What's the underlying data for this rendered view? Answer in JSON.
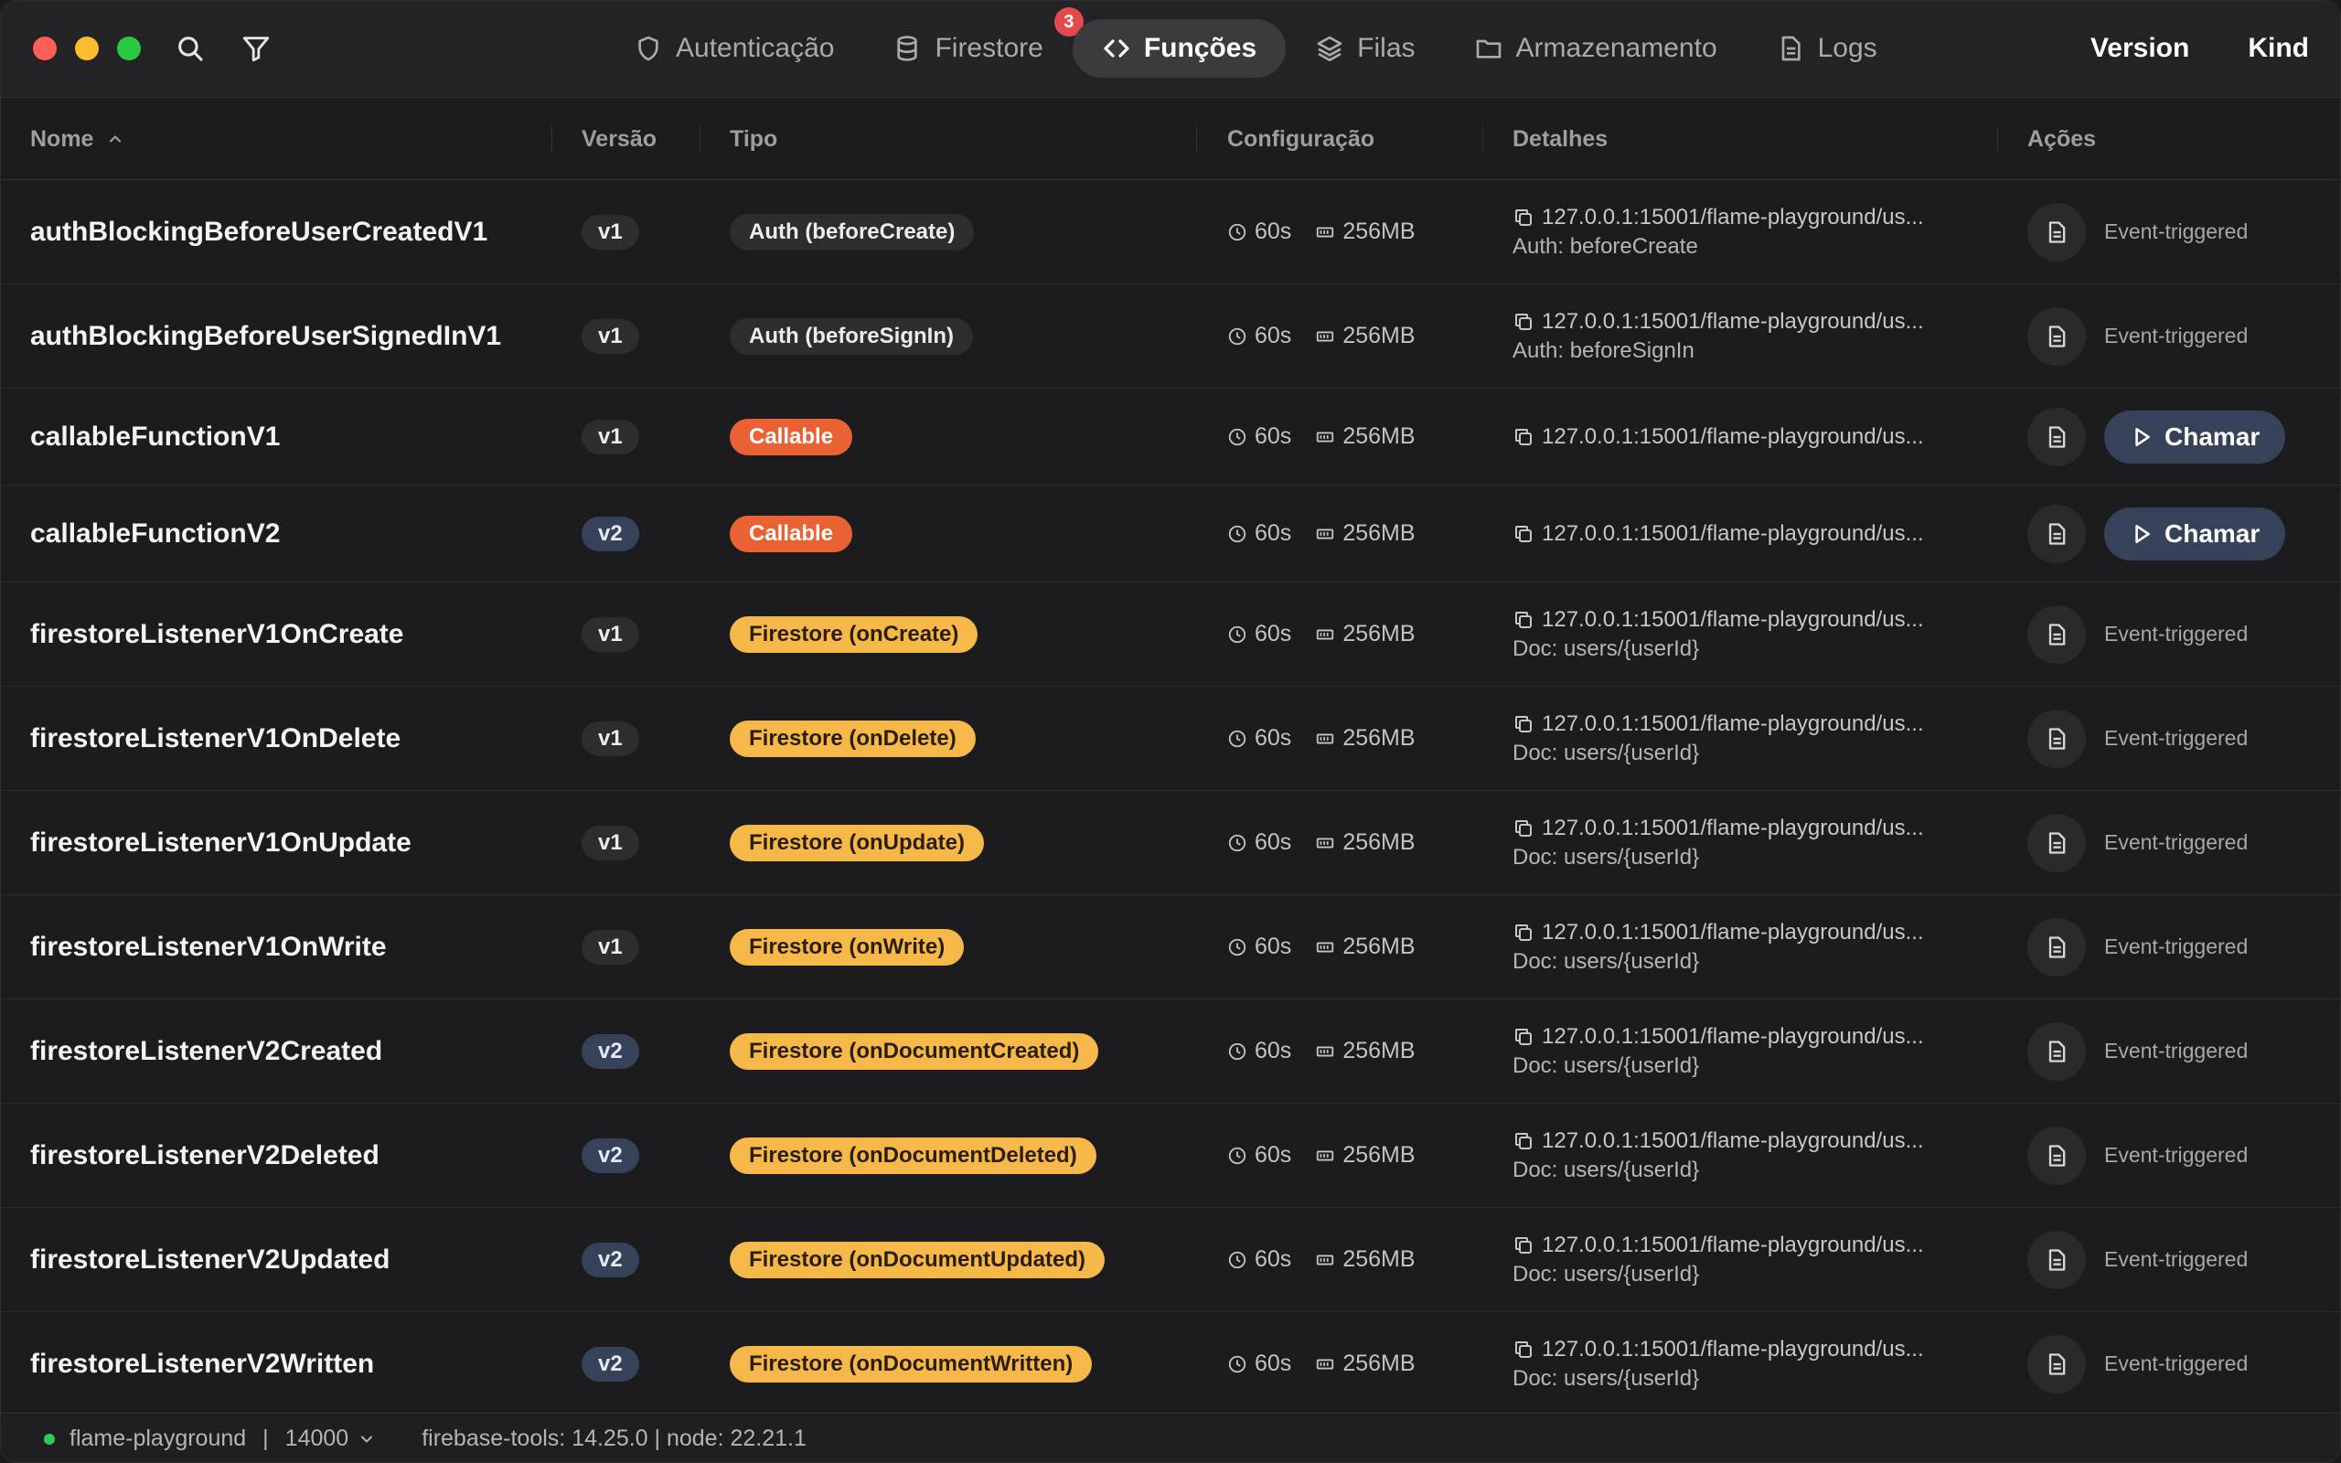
{
  "toolbar": {
    "tabs": [
      {
        "label": "Autenticação",
        "icon": "shield-icon",
        "badge": ""
      },
      {
        "label": "Firestore",
        "icon": "database-icon",
        "badge": "3"
      },
      {
        "label": "Funções",
        "icon": "code-icon",
        "badge": "",
        "active": true
      },
      {
        "label": "Filas",
        "icon": "layers-icon",
        "badge": ""
      },
      {
        "label": "Armazenamento",
        "icon": "folder-icon",
        "badge": ""
      },
      {
        "label": "Logs",
        "icon": "document-icon",
        "badge": ""
      }
    ],
    "right": {
      "version_label": "Version",
      "kind_label": "Kind"
    }
  },
  "table": {
    "headers": {
      "name": "Nome",
      "version": "Versão",
      "type": "Tipo",
      "config": "Configuração",
      "details": "Detalhes",
      "actions": "Ações"
    },
    "rows": [
      {
        "name": "authBlockingBeforeUserCreatedV1",
        "version": "v1",
        "type": "Auth (beforeCreate)",
        "type_kind": "auth",
        "timeout": "60s",
        "memory": "256MB",
        "url": "127.0.0.1:15001/flame-playground/us...",
        "detail": "Auth: beforeCreate",
        "action": "Event-triggered"
      },
      {
        "name": "authBlockingBeforeUserSignedInV1",
        "version": "v1",
        "type": "Auth (beforeSignIn)",
        "type_kind": "auth",
        "timeout": "60s",
        "memory": "256MB",
        "url": "127.0.0.1:15001/flame-playground/us...",
        "detail": "Auth: beforeSignIn",
        "action": "Event-triggered"
      },
      {
        "name": "callableFunctionV1",
        "version": "v1",
        "type": "Callable",
        "type_kind": "callable",
        "timeout": "60s",
        "memory": "256MB",
        "url": "127.0.0.1:15001/flame-playground/us...",
        "detail": "",
        "action": "Chamar"
      },
      {
        "name": "callableFunctionV2",
        "version": "v2",
        "type": "Callable",
        "type_kind": "callable",
        "timeout": "60s",
        "memory": "256MB",
        "url": "127.0.0.1:15001/flame-playground/us...",
        "detail": "",
        "action": "Chamar"
      },
      {
        "name": "firestoreListenerV1OnCreate",
        "version": "v1",
        "type": "Firestore (onCreate)",
        "type_kind": "firestore",
        "timeout": "60s",
        "memory": "256MB",
        "url": "127.0.0.1:15001/flame-playground/us...",
        "detail": "Doc: users/{userId}",
        "action": "Event-triggered"
      },
      {
        "name": "firestoreListenerV1OnDelete",
        "version": "v1",
        "type": "Firestore (onDelete)",
        "type_kind": "firestore",
        "timeout": "60s",
        "memory": "256MB",
        "url": "127.0.0.1:15001/flame-playground/us...",
        "detail": "Doc: users/{userId}",
        "action": "Event-triggered"
      },
      {
        "name": "firestoreListenerV1OnUpdate",
        "version": "v1",
        "type": "Firestore (onUpdate)",
        "type_kind": "firestore",
        "timeout": "60s",
        "memory": "256MB",
        "url": "127.0.0.1:15001/flame-playground/us...",
        "detail": "Doc: users/{userId}",
        "action": "Event-triggered"
      },
      {
        "name": "firestoreListenerV1OnWrite",
        "version": "v1",
        "type": "Firestore (onWrite)",
        "type_kind": "firestore",
        "timeout": "60s",
        "memory": "256MB",
        "url": "127.0.0.1:15001/flame-playground/us...",
        "detail": "Doc: users/{userId}",
        "action": "Event-triggered"
      },
      {
        "name": "firestoreListenerV2Created",
        "version": "v2",
        "type": "Firestore (onDocumentCreated)",
        "type_kind": "firestore",
        "timeout": "60s",
        "memory": "256MB",
        "url": "127.0.0.1:15001/flame-playground/us...",
        "detail": "Doc: users/{userId}",
        "action": "Event-triggered"
      },
      {
        "name": "firestoreListenerV2Deleted",
        "version": "v2",
        "type": "Firestore (onDocumentDeleted)",
        "type_kind": "firestore",
        "timeout": "60s",
        "memory": "256MB",
        "url": "127.0.0.1:15001/flame-playground/us...",
        "detail": "Doc: users/{userId}",
        "action": "Event-triggered"
      },
      {
        "name": "firestoreListenerV2Updated",
        "version": "v2",
        "type": "Firestore (onDocumentUpdated)",
        "type_kind": "firestore",
        "timeout": "60s",
        "memory": "256MB",
        "url": "127.0.0.1:15001/flame-playground/us...",
        "detail": "Doc: users/{userId}",
        "action": "Event-triggered"
      },
      {
        "name": "firestoreListenerV2Written",
        "version": "v2",
        "type": "Firestore (onDocumentWritten)",
        "type_kind": "firestore",
        "timeout": "60s",
        "memory": "256MB",
        "url": "127.0.0.1:15001/flame-playground/us...",
        "detail": "Doc: users/{userId}",
        "action": "Event-triggered"
      }
    ]
  },
  "status": {
    "project": "flame-playground",
    "separator": "|",
    "port": "14000",
    "info": "firebase-tools: 14.25.0 | node: 22.21.1"
  },
  "colors": {
    "accent_active_tab": "#3b3b3f",
    "callable": "#ea6234",
    "firestore": "#f7b84a",
    "v2_badge": "#364259",
    "badge_red": "#e5484d",
    "status_green": "#34c759"
  }
}
